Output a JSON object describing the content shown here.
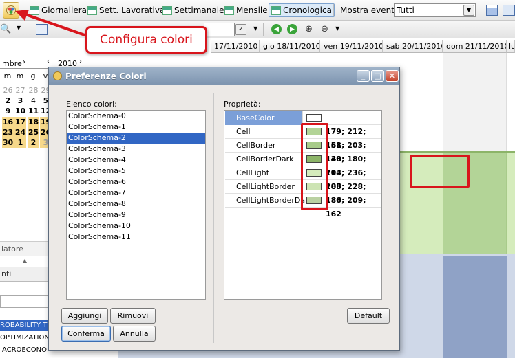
{
  "toolbar": {
    "items": [
      {
        "label": "Giornaliera"
      },
      {
        "label": "Sett. Lavorativa"
      },
      {
        "label": "Settimanale"
      },
      {
        "label": "Mensile"
      },
      {
        "label": "Cronologica"
      }
    ],
    "mostra_label": "Mostra eventi",
    "mostra_value": "Tutti"
  },
  "calendar_headers": [
    "17/11/2010",
    "gio 18/11/2010",
    "ven 19/11/2010",
    "sab 20/11/2010",
    "dom 21/11/2010",
    "lu"
  ],
  "mini_cal": {
    "month_partial": "mbre",
    "year": "2010",
    "weekday_headers": [
      "m",
      "m",
      "g",
      "v"
    ],
    "rows": [
      [
        "26",
        "27",
        "28",
        "29"
      ],
      [
        "2",
        "3",
        "4",
        "5"
      ],
      [
        "9",
        "10",
        "11",
        "12"
      ],
      [
        "16",
        "17",
        "18",
        "19"
      ],
      [
        "23",
        "24",
        "25",
        "26"
      ],
      [
        "30",
        "1",
        "2",
        "3"
      ]
    ]
  },
  "left_panel": {
    "section1": "latore",
    "section2": "nti",
    "items": [
      "ROBABILITY TH",
      "OPTIMIZATION",
      "IACROECONOMICS (ALTRATI"
    ]
  },
  "callout": {
    "text": "Configura colori"
  },
  "dialog": {
    "title": "Preferenze Colori",
    "list_label": "Elenco colori:",
    "props_label": "Proprietà:",
    "schemas": [
      "ColorSchema-0",
      "ColorSchema-1",
      "ColorSchema-2",
      "ColorSchema-3",
      "ColorSchema-4",
      "ColorSchema-5",
      "ColorSchema-6",
      "ColorSchema-7",
      "ColorSchema-8",
      "ColorSchema-9",
      "ColorSchema-10",
      "ColorSchema-11"
    ],
    "properties": [
      {
        "name": "BaseColor",
        "color": "#ffffff",
        "value": ""
      },
      {
        "name": "Cell",
        "color": "#b3d497",
        "value": "179; 212; 151"
      },
      {
        "name": "CellBorder",
        "color": "#a8cb8a",
        "value": "168; 203; 138"
      },
      {
        "name": "CellBorderDark",
        "color": "#8cb468",
        "value": "140; 180; 104"
      },
      {
        "name": "CellLight",
        "color": "#d5ecbc",
        "value": "213; 236; 188"
      },
      {
        "name": "CellLightBorder",
        "color": "#cde4b4",
        "value": "205; 228; 180"
      },
      {
        "name": "CellLightBorderDark",
        "color": "#bad1a2",
        "value": "186; 209; 162"
      }
    ],
    "buttons": {
      "add": "Aggiungi",
      "remove": "Rimuovi",
      "confirm": "Conferma",
      "cancel": "Annulla",
      "default": "Default"
    }
  },
  "colors": {
    "accent_red": "#d8151c",
    "selection": "#3166c4",
    "green_cell": "#b3d497",
    "green_light": "#d5ecbc",
    "blue_band": "#8fa2c6"
  }
}
